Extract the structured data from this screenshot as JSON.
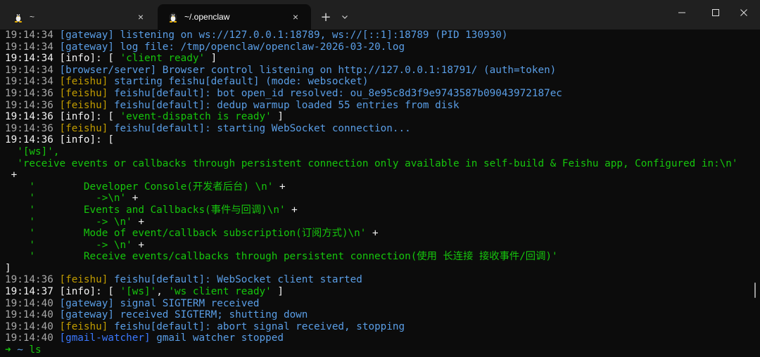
{
  "tabs": [
    {
      "label": "~"
    },
    {
      "label": "~/.openclaw"
    }
  ],
  "controls": {
    "new_tab": "+",
    "close": "×"
  },
  "colors": {
    "timestamp": "#a8a8a8",
    "gateway": "#5a9ee6",
    "feishu": "#c19c00",
    "string": "#16c60c",
    "gmail_watcher": "#3b78ff"
  },
  "terminal": {
    "lines": [
      [
        {
          "t": "19:14:34",
          "c": "ts"
        },
        {
          "t": " [gateway] listening on ws://127.0.0.1:18789, ws://[::1]:18789 (PID 130930)",
          "c": "c-blue"
        }
      ],
      [
        {
          "t": "19:14:34",
          "c": "ts"
        },
        {
          "t": " [gateway] log file: /tmp/openclaw/openclaw-2026-03-20.log",
          "c": "c-blue"
        }
      ],
      [
        {
          "t": "19:14:34",
          "c": "ts bright"
        },
        {
          "t": " [info]: [ ",
          "c": "c-white"
        },
        {
          "t": "'client ready'",
          "c": "c-green"
        },
        {
          "t": " ]",
          "c": "c-white"
        }
      ],
      [
        {
          "t": "19:14:34",
          "c": "ts"
        },
        {
          "t": " [browser/server] Browser control listening on http://127.0.0.1:18791/ (auth=token)",
          "c": "c-blue"
        }
      ],
      [
        {
          "t": "19:14:34",
          "c": "ts"
        },
        {
          "t": " [feishu]",
          "c": "c-yellow"
        },
        {
          "t": " starting feishu[default] (mode: websocket)",
          "c": "c-blue"
        }
      ],
      [
        {
          "t": "19:14:36",
          "c": "ts"
        },
        {
          "t": " [feishu]",
          "c": "c-yellow"
        },
        {
          "t": " feishu[default]: bot open_id resolved: ou_8e95c8d3f9e9743587b09043972187ec",
          "c": "c-blue"
        }
      ],
      [
        {
          "t": "19:14:36",
          "c": "ts"
        },
        {
          "t": " [feishu]",
          "c": "c-yellow"
        },
        {
          "t": " feishu[default]: dedup warmup loaded 55 entries from disk",
          "c": "c-blue"
        }
      ],
      [
        {
          "t": "19:14:36",
          "c": "ts bright"
        },
        {
          "t": " [info]: [ ",
          "c": "c-white"
        },
        {
          "t": "'event-dispatch is ready'",
          "c": "c-green"
        },
        {
          "t": " ]",
          "c": "c-white"
        }
      ],
      [
        {
          "t": "19:14:36",
          "c": "ts"
        },
        {
          "t": " [feishu]",
          "c": "c-yellow"
        },
        {
          "t": " feishu[default]: starting WebSocket connection...",
          "c": "c-blue"
        }
      ],
      [
        {
          "t": "19:14:36",
          "c": "ts bright"
        },
        {
          "t": " [info]: [",
          "c": "c-white"
        }
      ],
      [
        {
          "t": "  '[ws]',",
          "c": "c-green"
        }
      ],
      [
        {
          "t": "  'receive events or callbacks through persistent connection only available in self-build & Feishu app, Configured in:\\n'",
          "c": "c-green"
        }
      ],
      [
        {
          "t": " +",
          "c": "c-white"
        }
      ],
      [
        {
          "t": "    '        Developer Console(开发者后台) \\n'",
          "c": "c-green"
        },
        {
          "t": " +",
          "c": "c-white"
        }
      ],
      [
        {
          "t": "    '          ->\\n'",
          "c": "c-green"
        },
        {
          "t": " +",
          "c": "c-white"
        }
      ],
      [
        {
          "t": "    '        Events and Callbacks(事件与回调)\\n'",
          "c": "c-green"
        },
        {
          "t": " +",
          "c": "c-white"
        }
      ],
      [
        {
          "t": "    '          -> \\n'",
          "c": "c-green"
        },
        {
          "t": " +",
          "c": "c-white"
        }
      ],
      [
        {
          "t": "    '        Mode of event/callback subscription(订阅方式)\\n'",
          "c": "c-green"
        },
        {
          "t": " +",
          "c": "c-white"
        }
      ],
      [
        {
          "t": "    '          -> \\n'",
          "c": "c-green"
        },
        {
          "t": " +",
          "c": "c-white"
        }
      ],
      [
        {
          "t": "    '        Receive events/callbacks through persistent connection(使用 长连接 接收事件/回调)'",
          "c": "c-green"
        }
      ],
      [
        {
          "t": "]",
          "c": "c-white"
        }
      ],
      [
        {
          "t": "19:14:36",
          "c": "ts"
        },
        {
          "t": " [feishu]",
          "c": "c-yellow"
        },
        {
          "t": " feishu[default]: WebSocket client started",
          "c": "c-blue"
        }
      ],
      [
        {
          "t": "19:14:37",
          "c": "ts bright"
        },
        {
          "t": " [info]: [ ",
          "c": "c-white"
        },
        {
          "t": "'[ws]'",
          "c": "c-green"
        },
        {
          "t": ", ",
          "c": "c-white"
        },
        {
          "t": "'ws client ready'",
          "c": "c-green"
        },
        {
          "t": " ]",
          "c": "c-white"
        }
      ],
      [
        {
          "t": "19:14:40",
          "c": "ts"
        },
        {
          "t": " [gateway] signal SIGTERM received",
          "c": "c-blue"
        }
      ],
      [
        {
          "t": "19:14:40",
          "c": "ts"
        },
        {
          "t": " [gateway] received SIGTERM; shutting down",
          "c": "c-blue"
        }
      ],
      [
        {
          "t": "19:14:40",
          "c": "ts"
        },
        {
          "t": " [feishu]",
          "c": "c-yellow"
        },
        {
          "t": " feishu[default]: abort signal received, stopping",
          "c": "c-blue"
        }
      ],
      [
        {
          "t": "19:14:40",
          "c": "ts"
        },
        {
          "t": " [gmail-watcher]",
          "c": "c-darkblue"
        },
        {
          "t": " gmail watcher stopped",
          "c": "c-blue"
        }
      ],
      [
        {
          "t": "➜ ",
          "c": "c-green"
        },
        {
          "t": "~ ",
          "c": "c-blue"
        },
        {
          "t": "ls",
          "c": "c-green"
        }
      ]
    ]
  }
}
